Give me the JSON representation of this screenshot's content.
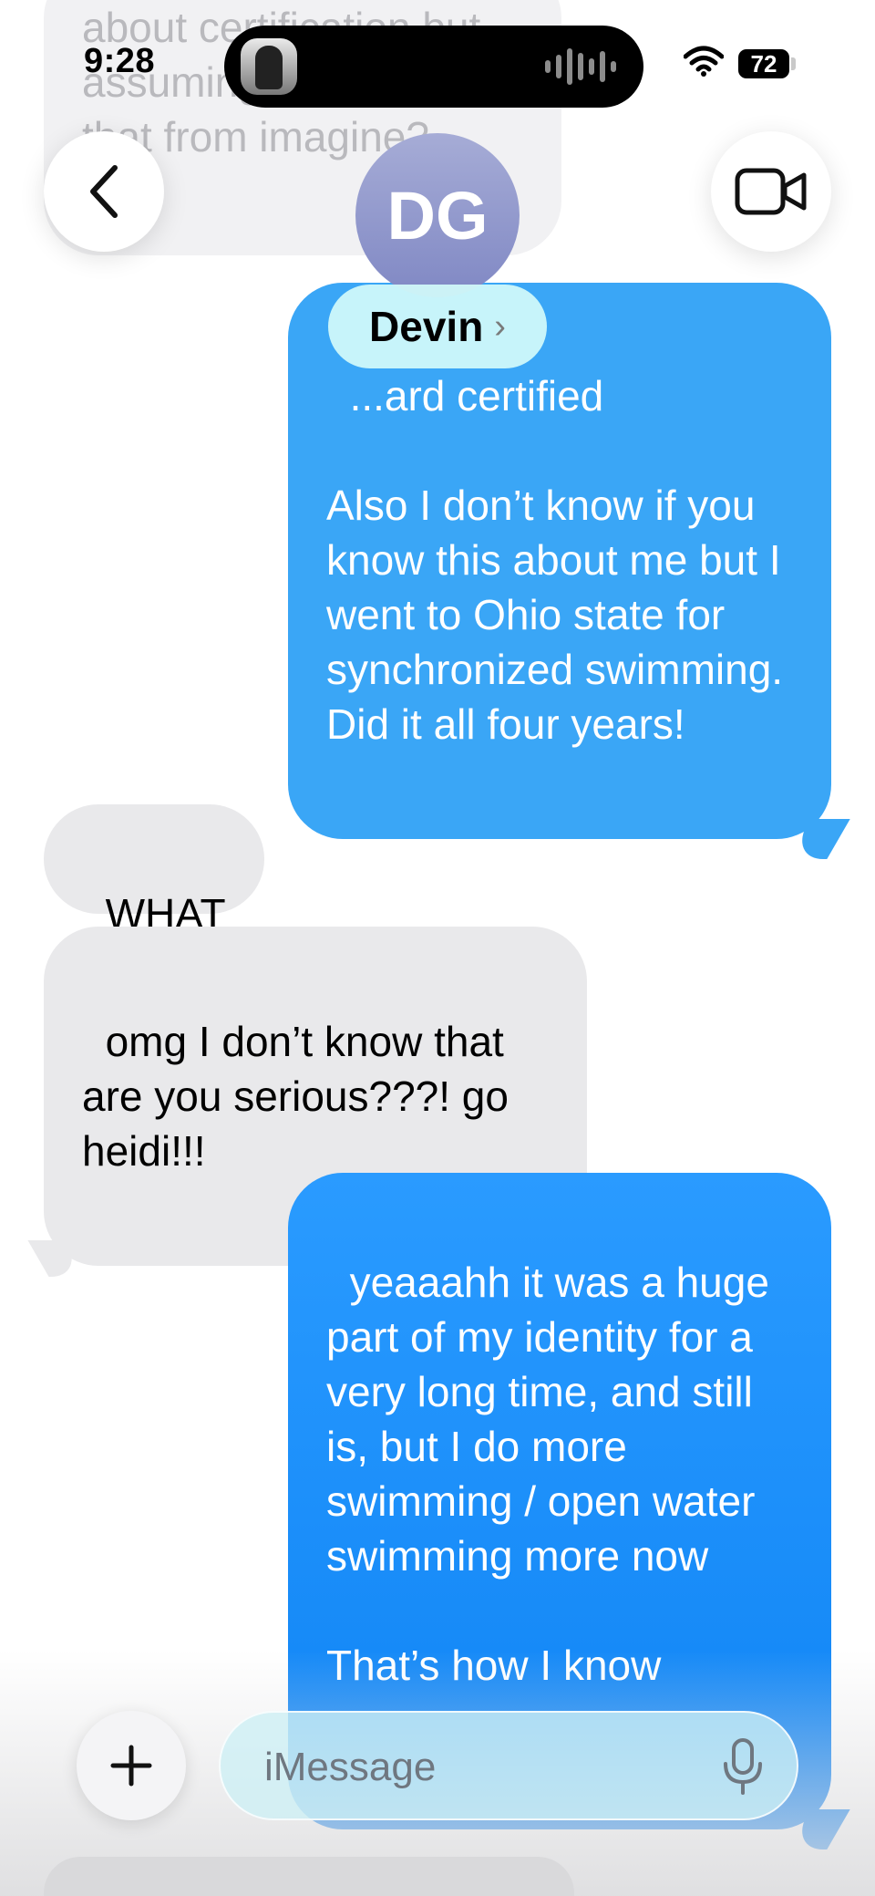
{
  "status_bar": {
    "time": "9:28",
    "battery": "72"
  },
  "header": {
    "initials": "DG",
    "contact_name": "Devin",
    "chevron": "›"
  },
  "messages": {
    "faded_top": "about certification\nbut assuming you\nhave that from\nimagine?",
    "sent_1": "...ard certified\n\nAlso I don’t know if you know this about me but I went to Ohio state for synchronized swimming. Did it all four years!",
    "received_1": "WHAT",
    "received_2": "omg I don’t know that are you serious???! go heidi!!!",
    "sent_2": "yeaaahh it was a huge part of my identity for a very long time, and still is, but I do more swimming / open water swimming more now\n\nThat’s how I know"
  },
  "composer": {
    "placeholder": "iMessage"
  },
  "colors": {
    "sent_bubble": "#3aa6f6",
    "received_bubble": "#e9e9eb",
    "avatar": "#8f96cc"
  },
  "icons": [
    "back-chevron-icon",
    "video-camera-icon",
    "plus-icon",
    "microphone-icon",
    "wifi-icon"
  ]
}
